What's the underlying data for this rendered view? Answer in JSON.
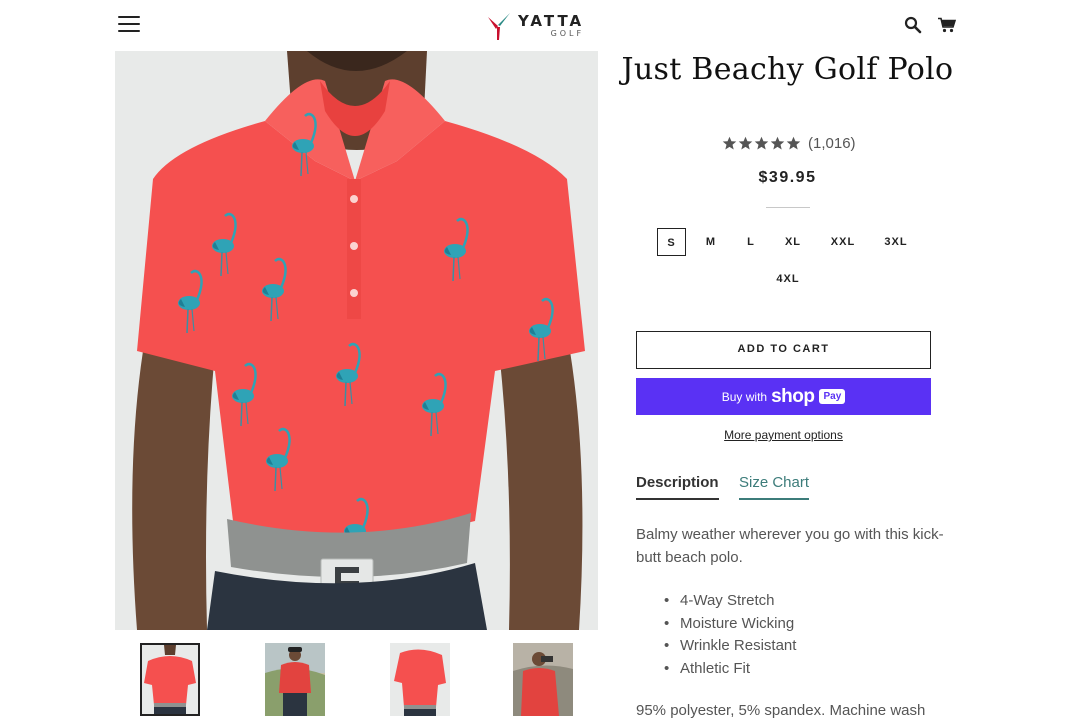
{
  "header": {
    "menu_icon": "hamburger-menu-icon",
    "logo": {
      "name": "YATTA",
      "sub": "GOLF",
      "colors": {
        "red": "#c8102e",
        "teal": "#2a8a85"
      }
    },
    "search_icon": "search-icon",
    "cart_icon": "cart-icon"
  },
  "gallery": {
    "main_image": "Model wearing coral polo with blue flamingo print",
    "thumbnails": [
      {
        "alt": "Front view coral polo",
        "active": true
      },
      {
        "alt": "Golfer in coral polo on course"
      },
      {
        "alt": "Side view coral polo"
      },
      {
        "alt": "Golfer using rangefinder"
      }
    ]
  },
  "product": {
    "title": "Just Beachy Golf Polo",
    "rating": {
      "stars": 5,
      "count": "(1,016)"
    },
    "price": "$39.95",
    "sizes": [
      "S",
      "M",
      "L",
      "XL",
      "XXL",
      "3XL",
      "4XL"
    ],
    "selected_size": "S",
    "add_to_cart": "ADD TO CART",
    "shop_pay": {
      "buy_with": "Buy with",
      "shop": "shop",
      "pay": "Pay"
    },
    "more_payment_options": "More payment options",
    "tabs": {
      "description": "Description",
      "size_chart": "Size Chart"
    },
    "description": "Balmy weather wherever you go with this kick-butt beach polo.",
    "features": [
      "4-Way Stretch",
      "Moisture Wicking",
      "Wrinkle Resistant",
      "Athletic Fit"
    ],
    "material": "95% polyester, 5% spandex. Machine wash"
  },
  "colors": {
    "shop_pay": "#5a31f4",
    "polo": "#f5504f",
    "flamingo": "#2fa3b6",
    "accent_tab": "#3c7c7a"
  }
}
